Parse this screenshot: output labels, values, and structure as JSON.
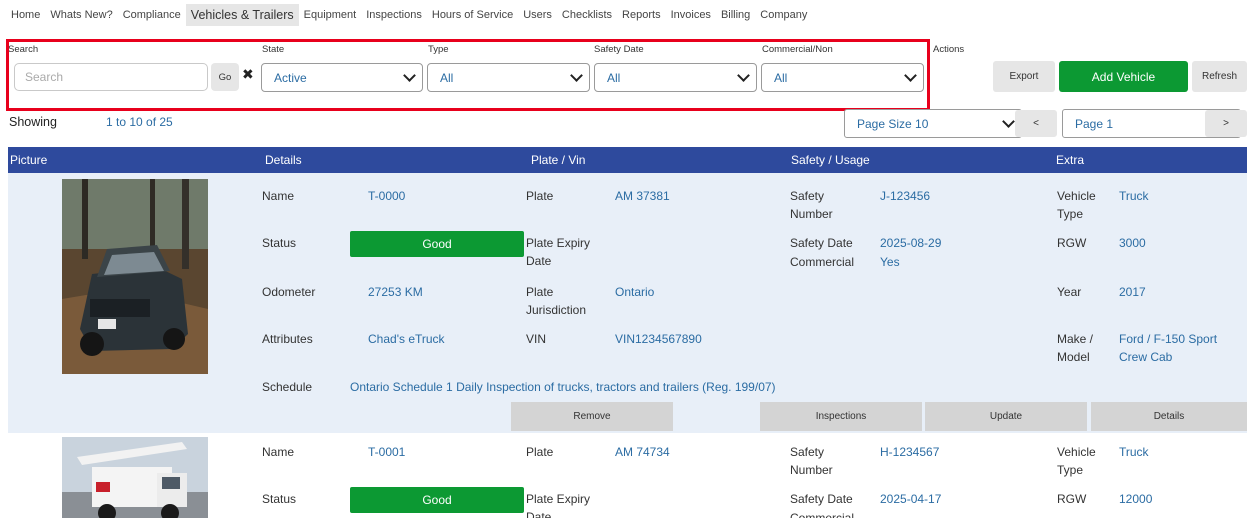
{
  "nav": {
    "items": [
      "Home",
      "Whats New?",
      "Compliance",
      "Vehicles & Trailers",
      "Equipment",
      "Inspections",
      "Hours of Service",
      "Users",
      "Checklists",
      "Reports",
      "Invoices",
      "Billing",
      "Company"
    ],
    "active": "Vehicles & Trailers"
  },
  "filters": {
    "search_label": "Search",
    "search_placeholder": "Search",
    "go_label": "Go",
    "clear_glyph": "✖",
    "state_label": "State",
    "state_value": "Active",
    "type_label": "Type",
    "type_value": "All",
    "safety_date_label": "Safety Date",
    "safety_date_value": "All",
    "commercial_label": "Commercial/Non",
    "commercial_value": "All",
    "actions_label": "Actions"
  },
  "actions": {
    "export": "Export",
    "add_vehicle": "Add Vehicle",
    "refresh": "Refresh"
  },
  "pagination": {
    "showing_label": "Showing",
    "showing_value": "1 to 10 of 25",
    "page_size": "Page Size 10",
    "prev": "<",
    "page": "Page 1",
    "next": ">"
  },
  "table": {
    "headers": [
      "Picture",
      "Details",
      "Plate / Vin",
      "Safety / Usage",
      "Extra"
    ]
  },
  "labels": {
    "name": "Name",
    "status": "Status",
    "odometer": "Odometer",
    "attributes": "Attributes",
    "schedule": "Schedule",
    "plate": "Plate",
    "plate_expiry_1": "Plate Expiry",
    "plate_expiry_2": "Date",
    "plate_jur_1": "Plate",
    "plate_jur_2": "Jurisdiction",
    "vin": "VIN",
    "safety_number_1": "Safety",
    "safety_number_2": "Number",
    "safety_date": "Safety Date",
    "commercial": "Commercial",
    "vehicle_type_1": "Vehicle",
    "vehicle_type_2": "Type",
    "rgw": "RGW",
    "year": "Year",
    "make_model_1": "Make /",
    "make_model_2": "Model"
  },
  "vehicles": [
    {
      "name": "T-0000",
      "status": "Good",
      "odometer": "27253  KM",
      "attributes": "Chad's eTruck",
      "schedule": "Ontario Schedule 1 Daily Inspection of trucks, tractors and trailers (Reg. 199/07)",
      "plate": "AM 37381",
      "plate_expiry": "",
      "jurisdiction": "Ontario",
      "vin": "VIN1234567890",
      "safety_number": "J-123456",
      "safety_date": "2025-08-29",
      "commercial": "Yes",
      "vehicle_type": "Truck",
      "rgw": "3000",
      "year": "2017",
      "make_model_1": "Ford / F-150 Sport",
      "make_model_2": "Crew Cab",
      "buttons": [
        "Remove",
        "Inspections",
        "Update",
        "Details"
      ]
    },
    {
      "name": "T-0001",
      "status": "Good",
      "plate": "AM 74734",
      "safety_number": "H-1234567",
      "safety_date": "2025-04-17",
      "vehicle_type": "Truck",
      "rgw": "12000"
    }
  ],
  "colors": {
    "header_bg": "#2e4a9d",
    "row_bg": "#e8eff8",
    "accent_green": "#0c9933",
    "link_blue": "#2b6ca3",
    "highlight_red": "#e8001c"
  }
}
